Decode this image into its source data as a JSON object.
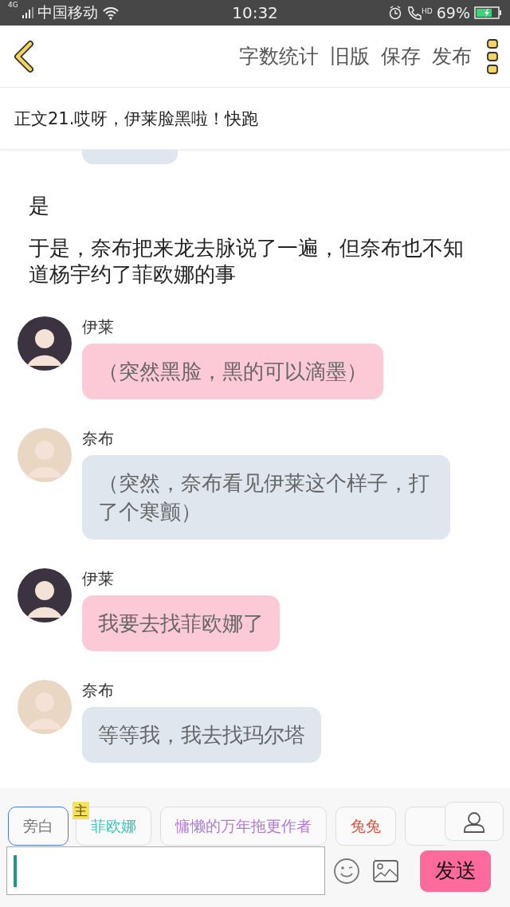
{
  "status_bar": {
    "network": "4G",
    "carrier": "中国移动",
    "time": "10:32",
    "call_badge": "HD",
    "battery": "69%",
    "charging": true
  },
  "header": {
    "actions": [
      "字数统计",
      "旧版",
      "保存",
      "发布"
    ]
  },
  "chapter_title": "正文21.哎呀，伊莱脸黑啦！快跑",
  "chat": [
    {
      "kind": "clipped_bubble",
      "color": "#dfe6ee"
    },
    {
      "kind": "narration",
      "text": "是"
    },
    {
      "kind": "narration",
      "text": "于是，奈布把来龙去脉说了一遍，但奈布也不知道杨宇约了菲欧娜的事"
    },
    {
      "kind": "message",
      "speaker": "伊莱",
      "color": "#fccad6",
      "text": "（突然黑脸，黑的可以滴墨）"
    },
    {
      "kind": "message",
      "speaker": "奈布",
      "color": "#dfe6ee",
      "text": "（突然，奈布看见伊莱这个样子，打了个寒颤）"
    },
    {
      "kind": "message",
      "speaker": "伊莱",
      "color": "#fccad6",
      "text": "我要去找菲欧娜了"
    },
    {
      "kind": "message",
      "speaker": "奈布",
      "color": "#dfe6ee",
      "text": "等等我，我去找玛尔塔"
    }
  ],
  "roles": [
    {
      "label": "旁白",
      "color": "#777777",
      "selected": true
    },
    {
      "label": "菲欧娜",
      "color": "#3cc4b4",
      "selected": false,
      "badge": "主"
    },
    {
      "label": "慵懒的万年拖更作者",
      "color": "#b07ad6",
      "selected": false
    },
    {
      "label": "兔兔",
      "color": "#e0503a",
      "selected": false
    },
    {
      "selected": false
    }
  ],
  "composer": {
    "send": "发送"
  }
}
